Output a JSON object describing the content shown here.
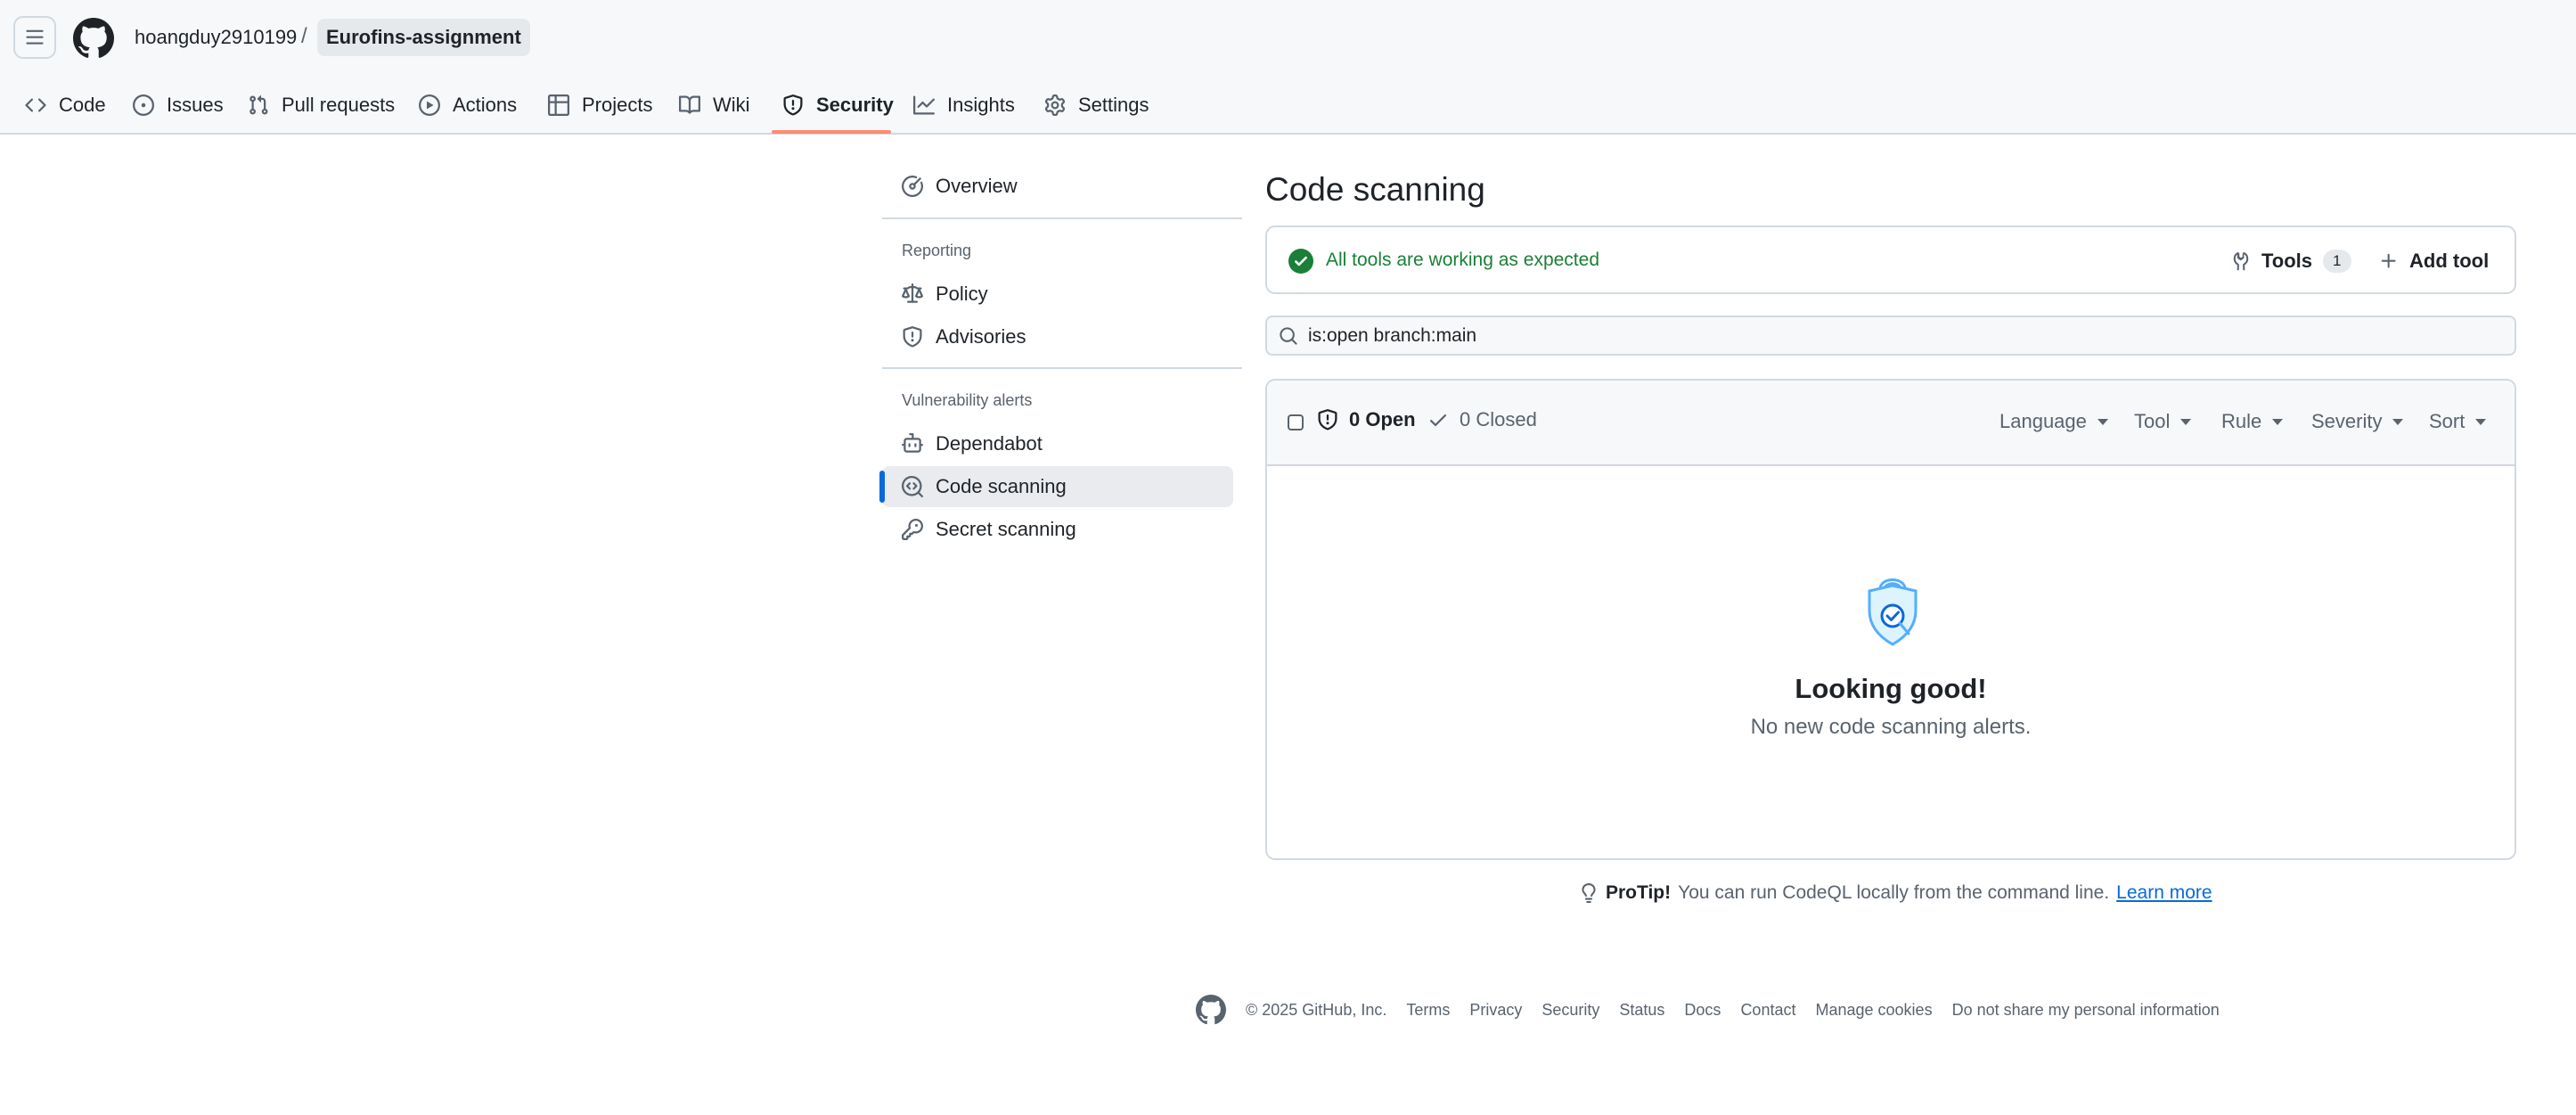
{
  "header": {
    "owner": "hoangduy2910199",
    "separator": "/",
    "repo": "Eurofins-assignment"
  },
  "tabs": [
    {
      "label": "Code",
      "icon": "code-icon"
    },
    {
      "label": "Issues",
      "icon": "issue-opened-icon"
    },
    {
      "label": "Pull requests",
      "icon": "git-pull-request-icon"
    },
    {
      "label": "Actions",
      "icon": "play-icon"
    },
    {
      "label": "Projects",
      "icon": "table-icon"
    },
    {
      "label": "Wiki",
      "icon": "book-icon"
    },
    {
      "label": "Security",
      "icon": "shield-icon",
      "active": true
    },
    {
      "label": "Insights",
      "icon": "graph-icon"
    },
    {
      "label": "Settings",
      "icon": "gear-icon"
    }
  ],
  "sidebar": {
    "overview": "Overview",
    "reporting_heading": "Reporting",
    "policy": "Policy",
    "advisories": "Advisories",
    "vuln_heading": "Vulnerability alerts",
    "dependabot": "Dependabot",
    "code_scanning": "Code scanning",
    "secret_scanning": "Secret scanning"
  },
  "main": {
    "title": "Code scanning",
    "status_text": "All tools are working as expected",
    "tools_label": "Tools",
    "tools_count": "1",
    "add_tool_label": "Add tool",
    "search_value": "is:open branch:main",
    "open_label": "0 Open",
    "closed_label": "0 Closed",
    "filters": [
      "Language",
      "Tool",
      "Rule",
      "Severity",
      "Sort"
    ],
    "blank_title": "Looking good!",
    "blank_desc": "No new code scanning alerts.",
    "protip_label": "ProTip!",
    "protip_text": "You can run CodeQL locally from the command line.",
    "protip_link": "Learn more"
  },
  "footer": {
    "copyright": "© 2025 GitHub, Inc.",
    "links": [
      "Terms",
      "Privacy",
      "Security",
      "Status",
      "Docs",
      "Contact",
      "Manage cookies",
      "Do not share my personal information"
    ]
  },
  "colors": {
    "accent_blue": "#0969da",
    "success_green": "#1a7f37",
    "tab_underline": "#fd8c73"
  }
}
